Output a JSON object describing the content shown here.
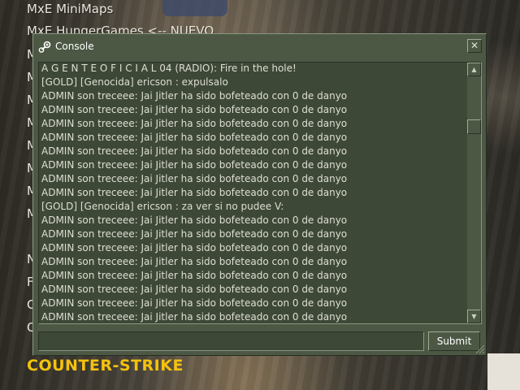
{
  "menu": {
    "item1": "MxE MiniMaps",
    "item2": "MxE HungerGames <-- NUEVO",
    "partial_letters": [
      "M",
      "M",
      "M",
      "M",
      "M",
      "M",
      "M",
      "M",
      "N",
      "F",
      "C",
      "Q"
    ]
  },
  "console": {
    "title": "Console",
    "lines": [
      "A G E N T E     O F I C I A L 04 (RADIO): Fire in the hole!",
      "[GOLD] [Genocida] ericson : expulsalo",
      "ADMIN son treceee: Jai Jitler ha sido bofeteado con 0 de danyo",
      "ADMIN son treceee: Jai Jitler ha sido bofeteado con 0 de danyo",
      "ADMIN son treceee: Jai Jitler ha sido bofeteado con 0 de danyo",
      "ADMIN son treceee: Jai Jitler ha sido bofeteado con 0 de danyo",
      "ADMIN son treceee: Jai Jitler ha sido bofeteado con 0 de danyo",
      "ADMIN son treceee: Jai Jitler ha sido bofeteado con 0 de danyo",
      "ADMIN son treceee: Jai Jitler ha sido bofeteado con 0 de danyo",
      "ADMIN son treceee: Jai Jitler ha sido bofeteado con 0 de danyo",
      "[GOLD] [Genocida] ericson : za ver si no pudee V:",
      "ADMIN son treceee: Jai Jitler ha sido bofeteado con 0 de danyo",
      "ADMIN son treceee: Jai Jitler ha sido bofeteado con 0 de danyo",
      "ADMIN son treceee: Jai Jitler ha sido bofeteado con 0 de danyo",
      "ADMIN son treceee: Jai Jitler ha sido bofeteado con 0 de danyo",
      "ADMIN son treceee: Jai Jitler ha sido bofeteado con 0 de danyo",
      "ADMIN son treceee: Jai Jitler ha sido bofeteado con 0 de danyo",
      "ADMIN son treceee: Jai Jitler ha sido bofeteado con 0 de danyo",
      "ADMIN son treceee: Jai Jitler ha sido bofeteado con 0 de danyo"
    ],
    "input_value": "",
    "submit_label": "Submit",
    "close_label": "✕",
    "scroll_up_label": "▲",
    "scroll_down_label": "▼",
    "icons": {
      "title": "steam-icon",
      "close": "close-icon",
      "scroll_up": "arrow-up-icon",
      "scroll_down": "arrow-down-icon",
      "resize": "resize-grip-icon"
    }
  },
  "logo": {
    "text": "COUNTER-STRIKE",
    "color": "#f4c20d"
  },
  "colors": {
    "console_bg": "#4c5844",
    "log_bg": "#3e4837",
    "text": "#dedfd4"
  }
}
